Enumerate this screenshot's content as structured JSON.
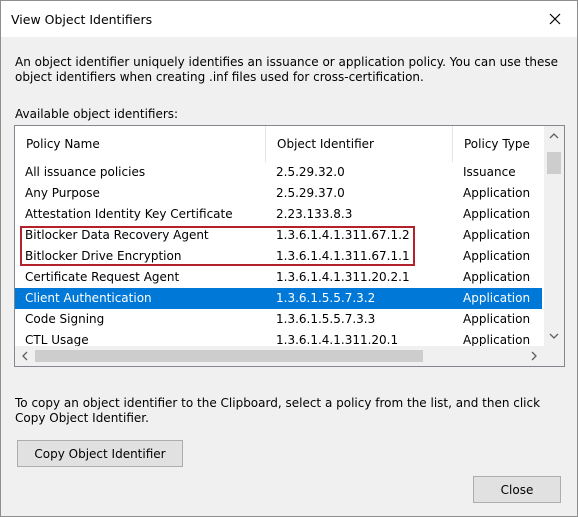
{
  "window": {
    "title": "View Object Identifiers"
  },
  "description": "An object identifier uniquely identifies an issuance or application policy. You can use these object identifiers when creating .inf files used for cross-certification.",
  "available_label": "Available object identifiers:",
  "table": {
    "columns": [
      "Policy Name",
      "Object Identifier",
      "Policy Type"
    ],
    "rows": [
      {
        "name": "All issuance policies",
        "oid": "2.5.29.32.0",
        "type": "Issuance"
      },
      {
        "name": "Any Purpose",
        "oid": "2.5.29.37.0",
        "type": "Application"
      },
      {
        "name": "Attestation Identity Key Certificate",
        "oid": "2.23.133.8.3",
        "type": "Application"
      },
      {
        "name": "Bitlocker Data Recovery Agent",
        "oid": "1.3.6.1.4.1.311.67.1.2",
        "type": "Application"
      },
      {
        "name": "Bitlocker Drive Encryption",
        "oid": "1.3.6.1.4.1.311.67.1.1",
        "type": "Application"
      },
      {
        "name": "Certificate Request Agent",
        "oid": "1.3.6.1.4.1.311.20.2.1",
        "type": "Application"
      },
      {
        "name": "Client Authentication",
        "oid": "1.3.6.1.5.5.7.3.2",
        "type": "Application"
      },
      {
        "name": "Code Signing",
        "oid": "1.3.6.1.5.5.7.3.3",
        "type": "Application"
      },
      {
        "name": "CTL Usage",
        "oid": "1.3.6.1.4.1.311.20.1",
        "type": "Application"
      }
    ],
    "selected_row": "Client Authentication"
  },
  "instruction": "To copy an object identifier to the Clipboard, select a policy from the list, and then click Copy Object Identifier.",
  "buttons": {
    "copy": "Copy Object Identifier",
    "close": "Close"
  },
  "colors": {
    "selection": "#0078d7",
    "highlight_border": "#b3222b"
  },
  "icons": {
    "close": "close-icon",
    "scroll_up": "chevron-up-icon",
    "scroll_down": "chevron-down-icon",
    "scroll_left": "chevron-left-icon",
    "scroll_right": "chevron-right-icon"
  }
}
